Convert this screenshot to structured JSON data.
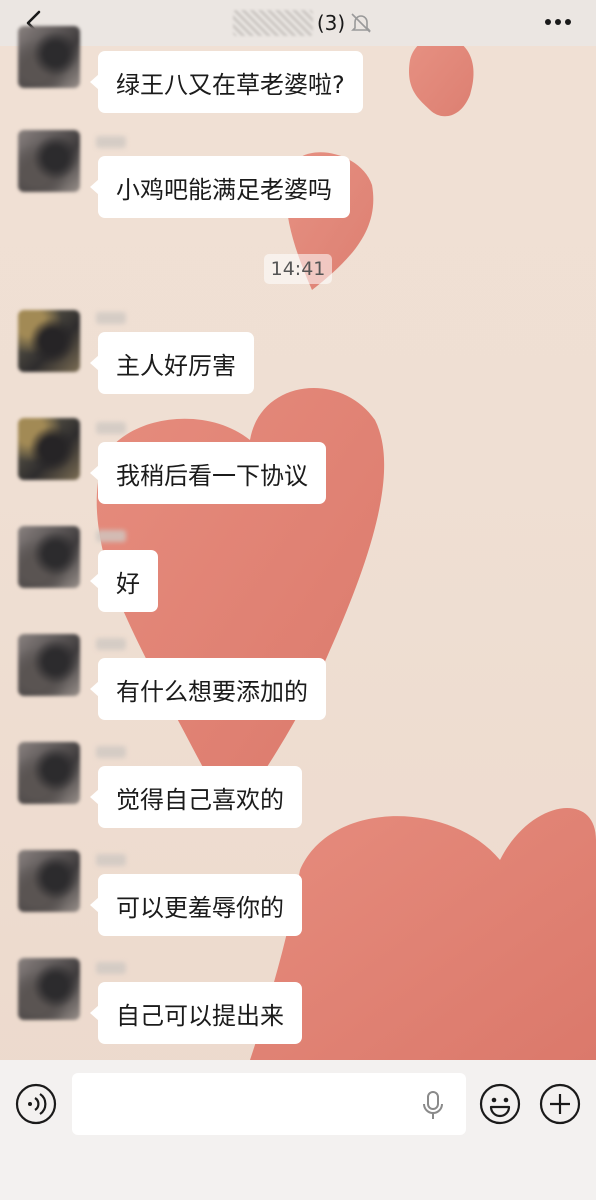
{
  "header": {
    "member_count": "(3)"
  },
  "chat": {
    "timestamp": "14:41",
    "messages": [
      {
        "text": "绿王八又在草老婆啦?"
      },
      {
        "text": "小鸡吧能满足老婆吗"
      },
      {
        "text": "主人好厉害"
      },
      {
        "text": "我稍后看一下协议"
      },
      {
        "text": "好"
      },
      {
        "text": "有什么想要添加的"
      },
      {
        "text": "觉得自己喜欢的"
      },
      {
        "text": "可以更羞辱你的"
      },
      {
        "text": "自己可以提出来"
      }
    ]
  },
  "input": {
    "value": "",
    "placeholder": ""
  },
  "icons": {
    "back": "chevron-left-icon",
    "mute": "bell-muted-icon",
    "more": "more-dots-icon",
    "voice": "voice-icon",
    "mic": "microphone-icon",
    "emoji": "emoji-icon",
    "add": "plus-icon"
  },
  "colors": {
    "bubble": "#ffffff",
    "heart": "#e0786a",
    "nav_bg": "#ebe6e2",
    "input_bar_bg": "#f3f1f0"
  }
}
